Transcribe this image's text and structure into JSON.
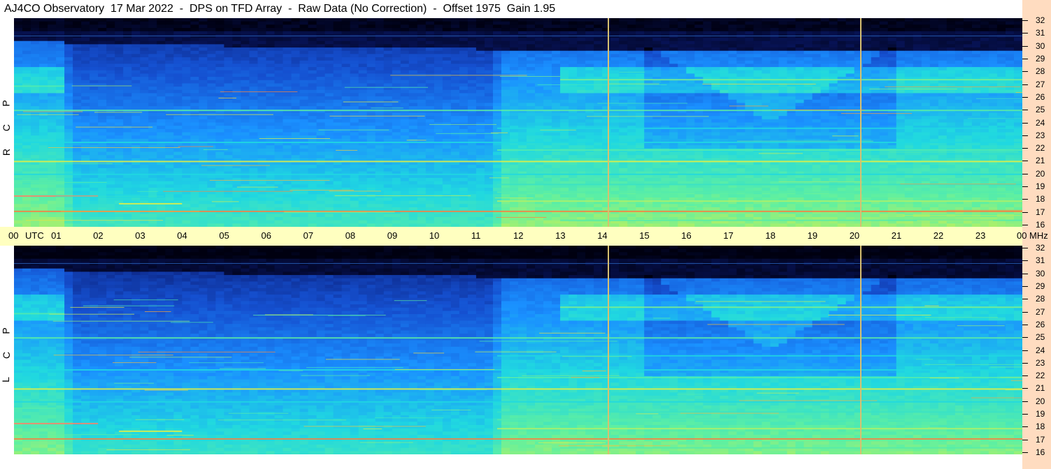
{
  "chart_data": {
    "type": "heatmap",
    "title": "AJ4CO Observatory  17 Mar 2022  -  DPS on TFD Array  -  Raw Data (No Correction)  -  Offset 1975  Gain 1.95",
    "time_axis": {
      "labels": [
        "00",
        "UTC",
        "01",
        "02",
        "03",
        "04",
        "05",
        "06",
        "07",
        "08",
        "09",
        "10",
        "11",
        "12",
        "13",
        "14",
        "15",
        "16",
        "17",
        "18",
        "19",
        "20",
        "21",
        "22",
        "23",
        "00"
      ],
      "hours": [
        0,
        0.25,
        1,
        2,
        3,
        4,
        5,
        6,
        7,
        8,
        9,
        10,
        11,
        12,
        13,
        14,
        15,
        16,
        17,
        18,
        19,
        20,
        21,
        22,
        23,
        24
      ],
      "range": [
        0,
        24
      ]
    },
    "frequency_axis": {
      "unit": "MHz",
      "range": [
        16,
        32
      ],
      "ticks": [
        16,
        17,
        18,
        19,
        20,
        21,
        22,
        23,
        24,
        25,
        26,
        27,
        28,
        29,
        30,
        31,
        32
      ]
    },
    "panels": [
      {
        "name": "R C P",
        "letters": [
          "R",
          "C",
          "P"
        ]
      },
      {
        "name": "L C P",
        "letters": [
          "L",
          "C",
          "P"
        ]
      }
    ],
    "marker_hours": [
      14.15,
      20.15
    ],
    "colormap": [
      "#000010",
      "#0a1a70",
      "#1550d0",
      "#1a90ff",
      "#20d8e0",
      "#60f0a0",
      "#e8f040",
      "#ff6040",
      "#ffffff"
    ]
  }
}
